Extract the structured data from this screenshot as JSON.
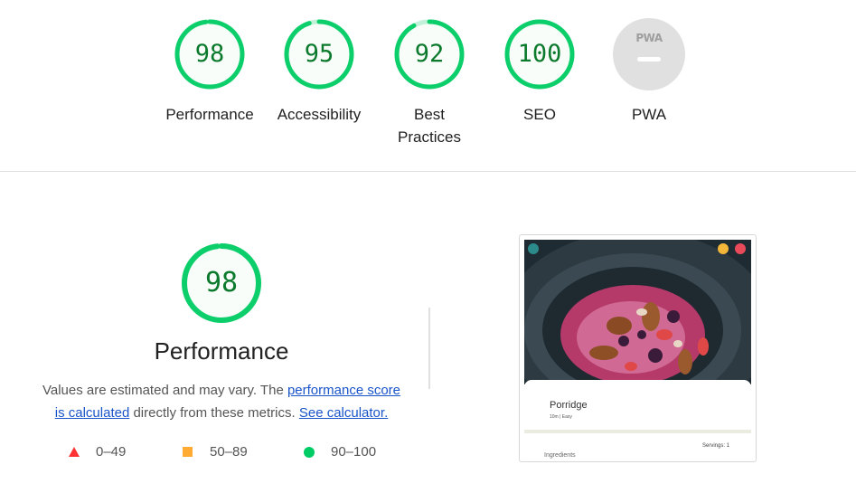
{
  "summary": {
    "gauges": [
      {
        "label": "Performance",
        "score": "98",
        "value": 98
      },
      {
        "label": "Accessibility",
        "score": "95",
        "value": 95
      },
      {
        "label": "Best Practices",
        "score": "92",
        "value": 92
      },
      {
        "label": "SEO",
        "score": "100",
        "value": 100
      }
    ],
    "pwa": {
      "badge_text": "PWA",
      "label": "PWA"
    }
  },
  "performance": {
    "score": "98",
    "value": 98,
    "title": "Performance",
    "desc_prefix": "Values are estimated and may vary. The ",
    "desc_link1": "performance score is calculated",
    "desc_middle": " directly from these metrics. ",
    "desc_link2": "See calculator."
  },
  "legend": [
    {
      "shape": "triangle",
      "range": "0–49",
      "color": "#ff3333"
    },
    {
      "shape": "square",
      "range": "50–89",
      "color": "#ffaa33"
    },
    {
      "shape": "circle",
      "range": "90–100",
      "color": "#00cc66"
    }
  ],
  "thumbnail": {
    "recipe_title": "Porridge",
    "recipe_meta": "10m | Easy",
    "servings": "Servings: 1",
    "ingredients": "Ingredients"
  },
  "colors": {
    "pass_green": "#0cce6b",
    "pass_text": "#0c7a2c",
    "pass_fill": "#e5f9ee"
  }
}
